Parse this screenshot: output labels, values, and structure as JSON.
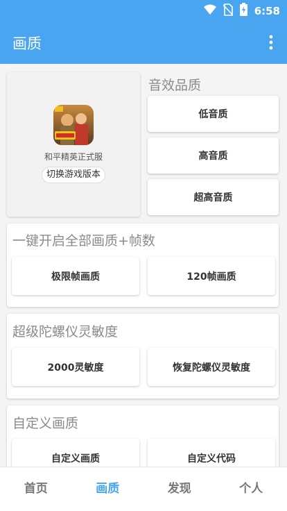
{
  "status_bar": {
    "time": "6:58",
    "icons": [
      "wifi-icon",
      "no-sim-icon",
      "battery-charging-icon"
    ]
  },
  "app_bar": {
    "title": "画质",
    "menu_icon": "more-vert-icon"
  },
  "game_card": {
    "name": "和平精英正式服",
    "switch_label": "切换游戏版本"
  },
  "audio_section": {
    "title": "音效品质",
    "buttons": [
      "低音质",
      "高音质",
      "超高音质"
    ]
  },
  "one_key_section": {
    "title": "一键开启全部画质+帧数",
    "buttons": [
      "极限帧画质",
      "120帧画质"
    ]
  },
  "gyro_section": {
    "title": "超级陀螺仪灵敏度",
    "buttons": [
      "2000灵敏度",
      "恢复陀螺仪灵敏度"
    ]
  },
  "custom_section": {
    "title": "自定义画质",
    "buttons": [
      "自定义画质",
      "自定义代码"
    ]
  },
  "tabs": [
    {
      "label": "首页",
      "active": false
    },
    {
      "label": "画质",
      "active": true
    },
    {
      "label": "发现",
      "active": false
    },
    {
      "label": "个人",
      "active": false
    }
  ],
  "colors": {
    "primary": "#4aa5f0",
    "section_title": "#8a8a8a"
  }
}
